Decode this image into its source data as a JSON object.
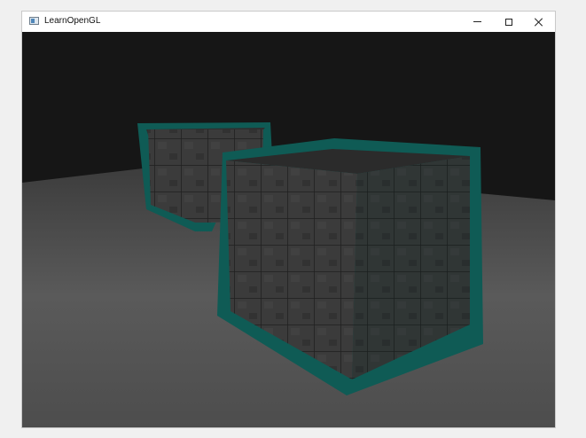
{
  "window": {
    "title": "LearnOpenGL",
    "controls": {
      "minimize_icon": "minimize-icon",
      "maximize_icon": "maximize-icon",
      "close_icon": "close-icon"
    }
  },
  "scene": {
    "background_color": "#151515",
    "floor_color": "#4a4a4a",
    "cube_color": "#3a3a3a",
    "outline_color": "#0f5b55"
  }
}
